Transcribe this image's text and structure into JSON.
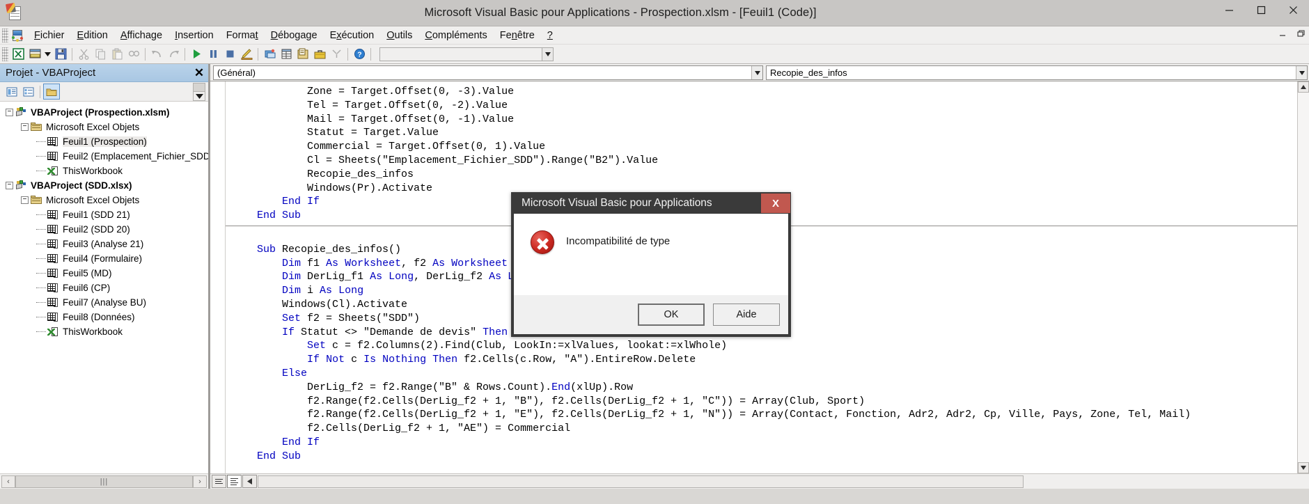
{
  "window": {
    "title": "Microsoft Visual Basic pour Applications - Prospection.xlsm - [Feuil1 (Code)]",
    "minimize_label": "–",
    "maximize_label": "❐",
    "close_label": "✕",
    "inner_minimize_label": "–",
    "inner_restore_label": "❐"
  },
  "menubar": {
    "items": [
      {
        "label": "Fichier",
        "accel": "F"
      },
      {
        "label": "Edition",
        "accel": "E"
      },
      {
        "label": "Affichage",
        "accel": "A"
      },
      {
        "label": "Insertion",
        "accel": "I"
      },
      {
        "label": "Format",
        "accel": "t"
      },
      {
        "label": "Débogage",
        "accel": "D"
      },
      {
        "label": "Exécution",
        "accel": "x"
      },
      {
        "label": "Outils",
        "accel": "O"
      },
      {
        "label": "Compléments",
        "accel": "C"
      },
      {
        "label": "Fenêtre",
        "accel": "n"
      },
      {
        "label": "?",
        "accel": ""
      }
    ]
  },
  "toolbar": {
    "combo_value": "",
    "combo_placeholder": "",
    "buttons": [
      "view-excel-icon",
      "insert-userform-icon",
      "dropdown-arrow-icon",
      "save-icon",
      "cut-icon",
      "copy-icon",
      "paste-icon",
      "find-icon",
      "undo-icon",
      "redo-icon",
      "run-icon",
      "pause-icon",
      "stop-icon",
      "design-mode-icon",
      "project-explorer-icon",
      "properties-window-icon",
      "object-browser-icon",
      "toolbox-icon",
      "help-icon"
    ]
  },
  "project_pane": {
    "title": "Projet - VBAProject",
    "close_label": "✕",
    "toolbar_buttons": [
      "view-code-icon",
      "view-object-icon",
      "toggle-folders-icon"
    ],
    "tree": [
      {
        "indent": 0,
        "expander": "−",
        "icon": "project-icon",
        "label": "VBAProject (Prospection.xlsm)",
        "bold": true,
        "selected": false
      },
      {
        "indent": 1,
        "expander": "−",
        "icon": "folder-icon",
        "label": "Microsoft Excel Objets",
        "bold": false,
        "selected": false
      },
      {
        "indent": 2,
        "expander": "",
        "icon": "sheet-icon",
        "label": "Feuil1 (Prospection)",
        "bold": false,
        "selected": true
      },
      {
        "indent": 2,
        "expander": "",
        "icon": "sheet-icon",
        "label": "Feuil2 (Emplacement_Fichier_SDD",
        "bold": false,
        "selected": false
      },
      {
        "indent": 2,
        "expander": "",
        "icon": "workbook-icon",
        "label": "ThisWorkbook",
        "bold": false,
        "selected": false
      },
      {
        "indent": 0,
        "expander": "−",
        "icon": "project-icon",
        "label": "VBAProject (SDD.xlsx)",
        "bold": true,
        "selected": false
      },
      {
        "indent": 1,
        "expander": "−",
        "icon": "folder-icon",
        "label": "Microsoft Excel Objets",
        "bold": false,
        "selected": false
      },
      {
        "indent": 2,
        "expander": "",
        "icon": "sheet-icon",
        "label": "Feuil1 (SDD 21)",
        "bold": false,
        "selected": false
      },
      {
        "indent": 2,
        "expander": "",
        "icon": "sheet-icon",
        "label": "Feuil2 (SDD 20)",
        "bold": false,
        "selected": false
      },
      {
        "indent": 2,
        "expander": "",
        "icon": "sheet-icon",
        "label": "Feuil3 (Analyse 21)",
        "bold": false,
        "selected": false
      },
      {
        "indent": 2,
        "expander": "",
        "icon": "sheet-icon",
        "label": "Feuil4 (Formulaire)",
        "bold": false,
        "selected": false
      },
      {
        "indent": 2,
        "expander": "",
        "icon": "sheet-icon",
        "label": "Feuil5 (MD)",
        "bold": false,
        "selected": false
      },
      {
        "indent": 2,
        "expander": "",
        "icon": "sheet-icon",
        "label": "Feuil6 (CP)",
        "bold": false,
        "selected": false
      },
      {
        "indent": 2,
        "expander": "",
        "icon": "sheet-icon",
        "label": "Feuil7 (Analyse BU)",
        "bold": false,
        "selected": false
      },
      {
        "indent": 2,
        "expander": "",
        "icon": "sheet-icon",
        "label": "Feuil8 (Données)",
        "bold": false,
        "selected": false
      },
      {
        "indent": 2,
        "expander": "",
        "icon": "workbook-icon",
        "label": "ThisWorkbook",
        "bold": false,
        "selected": false
      }
    ],
    "hscroll": {
      "left_label": "‹",
      "right_label": "›",
      "thumb_label": "|||"
    }
  },
  "code_pane": {
    "object_combo": "(Général)",
    "proc_combo": "Recopie_des_infos",
    "dropdown_arrow": "▾",
    "code_lines": [
      "            Zone = Target.Offset(0, -3).Value",
      "            Tel = Target.Offset(0, -2).Value",
      "            Mail = Target.Offset(0, -1).Value",
      "            Statut = Target.Value",
      "            Commercial = Target.Offset(0, 1).Value",
      "            Cl = Sheets(\"Emplacement_Fichier_SDD\").Range(\"B2\").Value",
      "            Recopie_des_infos",
      "            Windows(Pr).Activate",
      "        End If",
      "    End Sub",
      "",
      "    Sub Recopie_des_infos()",
      "        Dim f1 As Worksheet, f2 As Worksheet",
      "        Dim DerLig_f1 As Long, DerLig_f2 As Long",
      "        Dim i As Long",
      "        Windows(Cl).Activate",
      "        Set f2 = Sheets(\"SDD\")",
      "        If Statut <> \"Demande de devis\" Then",
      "            Set c = f2.Columns(2).Find(Club, LookIn:=xlValues, lookat:=xlWhole)",
      "            If Not c Is Nothing Then f2.Cells(c.Row, \"A\").EntireRow.Delete",
      "        Else",
      "            DerLig_f2 = f2.Range(\"B\" & Rows.Count).End(xlUp).Row",
      "            f2.Range(f2.Cells(DerLig_f2 + 1, \"B\"), f2.Cells(DerLig_f2 + 1, \"C\")) = Array(Club, Sport)",
      "            f2.Range(f2.Cells(DerLig_f2 + 1, \"E\"), f2.Cells(DerLig_f2 + 1, \"N\")) = Array(Contact, Fonction, Adr2, Adr2, Cp, Ville, Pays, Zone, Tel, Mail)",
      "            f2.Cells(DerLig_f2 + 1, \"AE\") = Commercial",
      "        End If",
      "    End Sub"
    ],
    "bottom_bar": {
      "procedure_view_label": "procedure-view-icon",
      "full_module_view_label": "full-module-view-icon",
      "scroll_left_label": "◀"
    }
  },
  "dialog": {
    "title": "Microsoft Visual Basic pour Applications",
    "close_label": "X",
    "message": "Incompatibilité de type",
    "icon": "error-icon",
    "buttons": [
      {
        "label": "OK",
        "default": true
      },
      {
        "label": "Aide",
        "default": false
      }
    ],
    "colors": {
      "titlebar": "#3a3a3a",
      "close": "#c1584f",
      "error": "#cc2a22"
    }
  }
}
